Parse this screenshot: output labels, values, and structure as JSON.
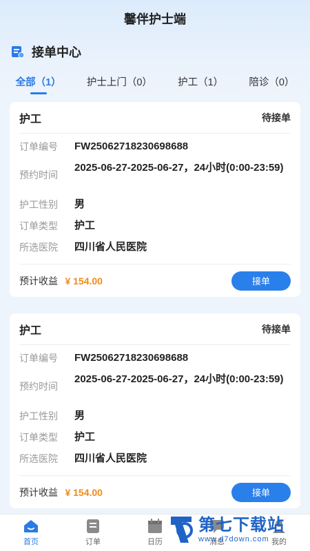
{
  "app": {
    "title": "馨伴护士端"
  },
  "section": {
    "title": "接单中心"
  },
  "tabs": [
    {
      "label": "全部（1）"
    },
    {
      "label": "护士上门（0）"
    },
    {
      "label": "护工（1）"
    },
    {
      "label": "陪诊（0）"
    }
  ],
  "cards": [
    {
      "type": "护工",
      "status": "待接单",
      "rows": [
        {
          "label": "订单编号",
          "value": "FW25062718230698688"
        },
        {
          "label": "预约时间",
          "value": "2025-06-27-2025-06-27，24小时(0:00-23:59)"
        },
        {
          "label": "护工性别",
          "value": "男"
        },
        {
          "label": "订单类型",
          "value": "护工"
        },
        {
          "label": "所选医院",
          "value": "四川省人民医院"
        }
      ],
      "earnings_label": "预计收益",
      "earnings_value": "¥ 154.00",
      "button": "接单"
    },
    {
      "type": "护工",
      "status": "待接单",
      "rows": [
        {
          "label": "订单编号",
          "value": "FW25062718230698688"
        },
        {
          "label": "预约时间",
          "value": "2025-06-27-2025-06-27，24小时(0:00-23:59)"
        },
        {
          "label": "护工性别",
          "value": "男"
        },
        {
          "label": "订单类型",
          "value": "护工"
        },
        {
          "label": "所选医院",
          "value": "四川省人民医院"
        }
      ],
      "earnings_label": "预计收益",
      "earnings_value": "¥ 154.00",
      "button": "接单"
    }
  ],
  "nav": [
    {
      "label": "首页",
      "icon": "home-icon"
    },
    {
      "label": "订单",
      "icon": "order-icon"
    },
    {
      "label": "日历",
      "icon": "calendar-icon"
    },
    {
      "label": "消息",
      "icon": "message-icon"
    },
    {
      "label": "我的",
      "icon": "profile-icon"
    }
  ],
  "watermark": {
    "title": "第七下载站",
    "url": "www.d7down.com"
  },
  "colors": {
    "accent": "#2a80ea",
    "earnings": "#f08a1d"
  }
}
